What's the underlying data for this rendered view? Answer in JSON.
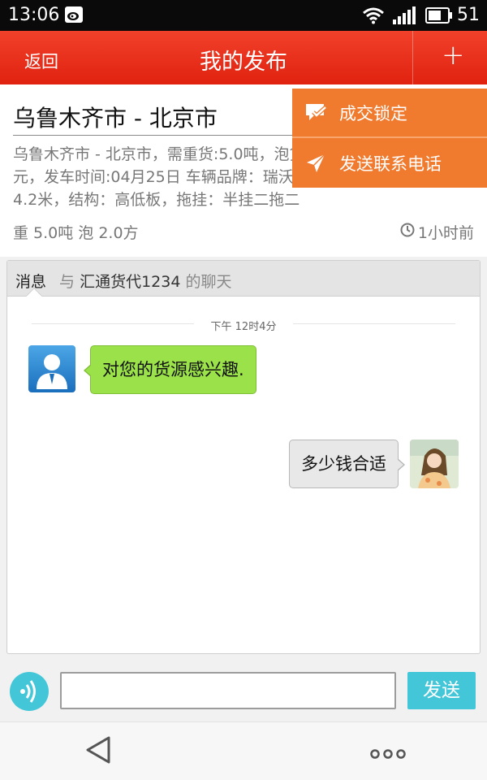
{
  "status_bar": {
    "time": "13:06",
    "battery_level": "51"
  },
  "header": {
    "back_label": "返回",
    "title": "我的发布",
    "add_label": "+"
  },
  "shipment": {
    "route": "乌鲁木齐市 - 北京市",
    "description": "乌鲁木齐市 - 北京市，需重货:5.0吨，泡货:2.0方，运价:3000.0元，发车时间:04月25日 车辆品牌：瑞沃 ，载重：5.0吨，车长：4.2米，结构：高低板，拖挂：半挂二拖二",
    "weight_info": "重 5.0吨   泡 2.0方",
    "time_ago": "1小时前"
  },
  "popup_menu": {
    "items": [
      {
        "label": "成交锁定",
        "icon": "deal-lock-icon"
      },
      {
        "label": "发送联系电话",
        "icon": "send-arrow-icon"
      }
    ]
  },
  "chat": {
    "tab_label": "消息",
    "with_prefix": "与",
    "contact_name": "汇通货代1234",
    "with_suffix": "的聊天",
    "timestamp": "下午 12时4分",
    "messages": [
      {
        "side": "left",
        "text": "对您的货源感兴趣."
      },
      {
        "side": "right",
        "text": "多少钱合适"
      }
    ]
  },
  "input_bar": {
    "placeholder": "",
    "value": "",
    "send_label": "发送"
  },
  "colors": {
    "header": "#e5281a",
    "popup": "#f07a2e",
    "bubble_in": "#9be24a",
    "accent": "#43c7d8"
  }
}
